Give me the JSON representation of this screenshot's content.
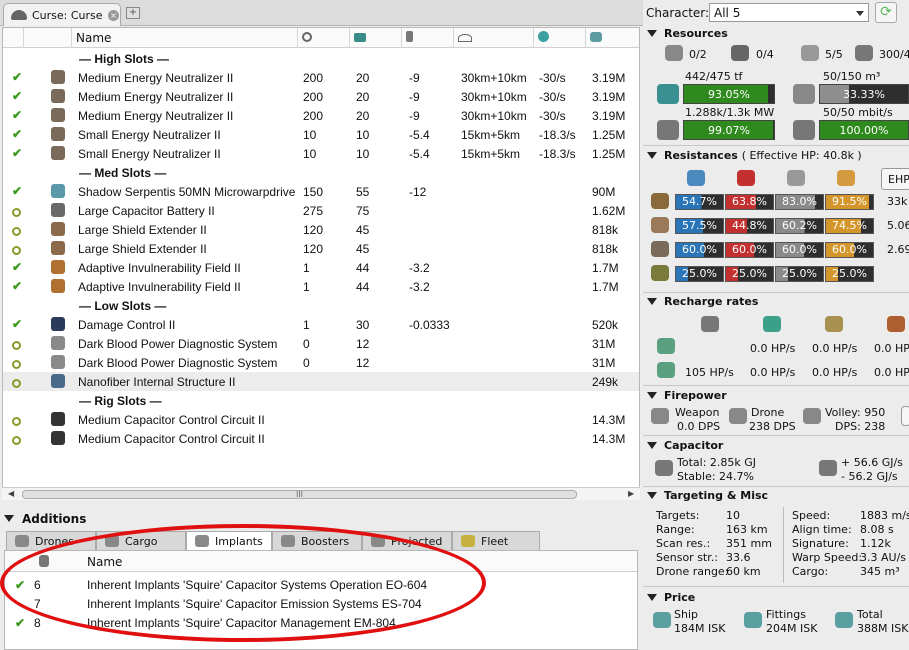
{
  "tab": {
    "title": "Curse: Curse",
    "icon": "ship-icon"
  },
  "columns": [
    "Name"
  ],
  "column_icons": [
    "cpu-icon",
    "powergrid-icon",
    "capacitor-icon",
    "range-icon",
    "optimal-icon",
    "price-icon"
  ],
  "sections": {
    "high": "— High Slots —",
    "med": "— Med Slots —",
    "low": "— Low Slots —",
    "rig": "— Rig Slots —"
  },
  "modules": [
    {
      "name": "Medium Energy Neutralizer II",
      "c1": "200",
      "c2": "20",
      "c3": "-9",
      "c4": "30km+10km",
      "c5": "-30/s",
      "c6": "3.19M",
      "state": "check"
    },
    {
      "name": "Medium Energy Neutralizer II",
      "c1": "200",
      "c2": "20",
      "c3": "-9",
      "c4": "30km+10km",
      "c5": "-30/s",
      "c6": "3.19M",
      "state": "check"
    },
    {
      "name": "Medium Energy Neutralizer II",
      "c1": "200",
      "c2": "20",
      "c3": "-9",
      "c4": "30km+10km",
      "c5": "-30/s",
      "c6": "3.19M",
      "state": "check"
    },
    {
      "name": "Small Energy Neutralizer II",
      "c1": "10",
      "c2": "10",
      "c3": "-5.4",
      "c4": "15km+5km",
      "c5": "-18.3/s",
      "c6": "1.25M",
      "state": "check"
    },
    {
      "name": "Small Energy Neutralizer II",
      "c1": "10",
      "c2": "10",
      "c3": "-5.4",
      "c4": "15km+5km",
      "c5": "-18.3/s",
      "c6": "1.25M",
      "state": "check"
    },
    {
      "name": "Shadow Serpentis 50MN Microwarpdrive",
      "c1": "150",
      "c2": "55",
      "c3": "-12",
      "c4": "",
      "c5": "",
      "c6": "90M",
      "state": "check"
    },
    {
      "name": "Large Capacitor Battery II",
      "c1": "275",
      "c2": "75",
      "c3": "",
      "c4": "",
      "c5": "",
      "c6": "1.62M",
      "state": "ring"
    },
    {
      "name": "Large Shield Extender II",
      "c1": "120",
      "c2": "45",
      "c3": "",
      "c4": "",
      "c5": "",
      "c6": "818k",
      "state": "ring"
    },
    {
      "name": "Large Shield Extender II",
      "c1": "120",
      "c2": "45",
      "c3": "",
      "c4": "",
      "c5": "",
      "c6": "818k",
      "state": "ring"
    },
    {
      "name": "Adaptive Invulnerability Field II",
      "c1": "1",
      "c2": "44",
      "c3": "-3.2",
      "c4": "",
      "c5": "",
      "c6": "1.7M",
      "state": "check"
    },
    {
      "name": "Adaptive Invulnerability Field II",
      "c1": "1",
      "c2": "44",
      "c3": "-3.2",
      "c4": "",
      "c5": "",
      "c6": "1.7M",
      "state": "check"
    },
    {
      "name": "Damage Control II",
      "c1": "1",
      "c2": "30",
      "c3": "-0.0333",
      "c4": "",
      "c5": "",
      "c6": "520k",
      "state": "check"
    },
    {
      "name": "Dark Blood Power Diagnostic System",
      "c1": "0",
      "c2": "12",
      "c3": "",
      "c4": "",
      "c5": "",
      "c6": "31M",
      "state": "ring"
    },
    {
      "name": "Dark Blood Power Diagnostic System",
      "c1": "0",
      "c2": "12",
      "c3": "",
      "c4": "",
      "c5": "",
      "c6": "31M",
      "state": "ring"
    },
    {
      "name": "Nanofiber Internal Structure II",
      "c1": "",
      "c2": "",
      "c3": "",
      "c4": "",
      "c5": "",
      "c6": "249k",
      "state": "ring"
    },
    {
      "name": "Medium Capacitor Control Circuit II",
      "c1": "",
      "c2": "",
      "c3": "",
      "c4": "",
      "c5": "",
      "c6": "14.3M",
      "state": "ring"
    },
    {
      "name": "Medium Capacitor Control Circuit II",
      "c1": "",
      "c2": "",
      "c3": "",
      "c4": "",
      "c5": "",
      "c6": "14.3M",
      "state": "ring"
    }
  ],
  "scroll_grip": "III",
  "additions": {
    "title": "Additions",
    "tabs": [
      "Drones",
      "Cargo",
      "Implants",
      "Boosters",
      "Projected",
      "Fleet"
    ],
    "column": "Name",
    "implants": [
      {
        "slot": "6",
        "name": "Inherent Implants 'Squire' Capacitor Systems Operation EO-604",
        "state": "check"
      },
      {
        "slot": "7",
        "name": "Inherent Implants 'Squire' Capacitor Emission Systems ES-704",
        "state": "none"
      },
      {
        "slot": "8",
        "name": "Inherent Implants 'Squire' Capacitor Management EM-804",
        "state": "check"
      }
    ]
  },
  "character": {
    "label": "Character:",
    "value": "All 5"
  },
  "resources": {
    "title": "Resources",
    "counts": [
      "0/2",
      "0/4",
      "5/5",
      "300/4"
    ],
    "cpu_text": "442/475 tf",
    "cpu_pct": "93.05%",
    "cpu_frac": 0.9305,
    "dronebay_text": "50/150 m³",
    "dronebay_pct": "33.33%",
    "dronebay_frac": 0.3333,
    "pg_text": "1.288k/1.3k MW",
    "pg_pct": "99.07%",
    "pg_frac": 0.9907,
    "bw_text": "50/50 mbit/s",
    "bw_pct": "100.00%",
    "bw_frac": 1.0
  },
  "resistances": {
    "title": "Resistances",
    "ehp": "( Effective HP: 40.8k )",
    "ehp_button": "EHP",
    "rows": [
      {
        "vals": [
          "54.7%",
          "63.8%",
          "83.0%",
          "91.5%"
        ],
        "fracs": [
          0.547,
          0.638,
          0.83,
          0.915
        ],
        "hp": "33k"
      },
      {
        "vals": [
          "57.5%",
          "44.8%",
          "60.2%",
          "74.5%"
        ],
        "fracs": [
          0.575,
          0.448,
          0.602,
          0.745
        ],
        "hp": "5.06"
      },
      {
        "vals": [
          "60.0%",
          "60.0%",
          "60.0%",
          "60.0%"
        ],
        "fracs": [
          0.6,
          0.6,
          0.6,
          0.6
        ],
        "hp": "2.69"
      },
      {
        "vals": [
          "25.0%",
          "25.0%",
          "25.0%",
          "25.0%"
        ],
        "fracs": [
          0.25,
          0.25,
          0.25,
          0.25
        ],
        "hp": ""
      }
    ],
    "colors": [
      "#2a74b8",
      "#c43030",
      "#8a8a8a",
      "#d4962a"
    ]
  },
  "recharge": {
    "title": "Recharge rates",
    "row1": [
      "0.0 HP/s",
      "0.0 HP/s",
      "0.0 HP/"
    ],
    "row2": [
      "105 HP/s",
      "0.0 HP/s",
      "0.0 HP/s",
      "0.0 HP/"
    ]
  },
  "firepower": {
    "title": "Firepower",
    "weapon_l": "Weapon",
    "weapon_v": "0.0 DPS",
    "drone_l": "Drone",
    "drone_v": "238 DPS",
    "volley": "Volley: 950",
    "dps": "DPS: 238"
  },
  "capacitor": {
    "title": "Capacitor",
    "total": "Total: 2.85k GJ",
    "stable": "Stable: 24.7%",
    "plus": "+ 56.6 GJ/s",
    "minus": "- 56.2 GJ/s"
  },
  "targeting": {
    "title": "Targeting & Misc",
    "left": [
      [
        "Targets:",
        "10"
      ],
      [
        "Range:",
        "163 km"
      ],
      [
        "Scan res.:",
        "351 mm"
      ],
      [
        "Sensor str.:",
        "33.6"
      ],
      [
        "Drone range:",
        "60 km"
      ]
    ],
    "right": [
      [
        "Speed:",
        "1883 m/s"
      ],
      [
        "Align time:",
        "8.08 s"
      ],
      [
        "Signature:",
        "1.12k"
      ],
      [
        "Warp Speed:",
        "3.3 AU/s"
      ],
      [
        "Cargo:",
        "345 m³"
      ]
    ]
  },
  "price": {
    "title": "Price",
    "ship_l": "Ship",
    "ship_v": "184M ISK",
    "fit_l": "Fittings",
    "fit_v": "204M ISK",
    "total_l": "Total",
    "total_v": "388M ISK"
  }
}
